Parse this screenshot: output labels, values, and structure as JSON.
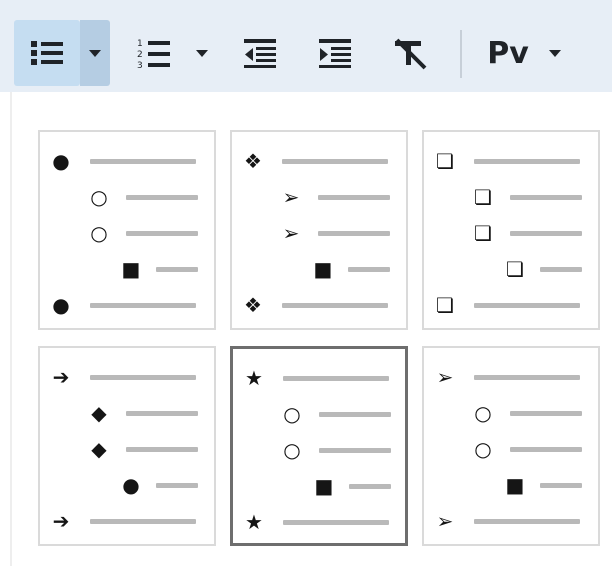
{
  "toolbar": {
    "bullets_button": "bulleted-list",
    "numbering_button": "numbered-list",
    "decrease_indent": "decrease-indent",
    "increase_indent": "increase-indent",
    "clear_format": "clear-formatting",
    "style_label": "Pv",
    "accent": "#c5ddf1"
  },
  "bullet_library": {
    "tiles": [
      {
        "bullets": [
          "●",
          "○",
          "○",
          "■",
          "●"
        ],
        "selected": false
      },
      {
        "bullets": [
          "❖",
          "➢",
          "➢",
          "■",
          "❖"
        ],
        "selected": false
      },
      {
        "bullets": [
          "❏",
          "❏",
          "❏",
          "❏",
          "❏"
        ],
        "selected": false
      },
      {
        "bullets": [
          "➔",
          "◆",
          "◆",
          "●",
          "➔"
        ],
        "selected": false
      },
      {
        "bullets": [
          "★",
          "○",
          "○",
          "■",
          "★"
        ],
        "selected": true
      },
      {
        "bullets": [
          "➢",
          "○",
          "○",
          "■",
          "➢"
        ],
        "selected": false
      }
    ]
  }
}
